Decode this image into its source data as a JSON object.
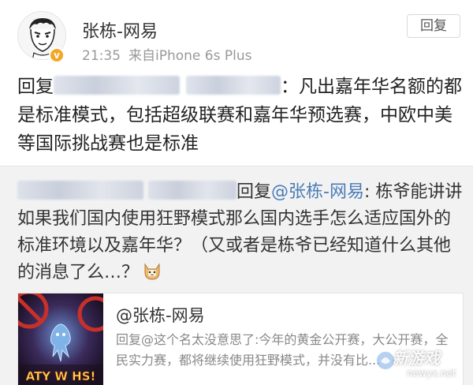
{
  "post": {
    "author": "张栋-网易",
    "time": "21:35",
    "source": "来自iPhone 6s Plus",
    "reply_button": "回复",
    "reply_prefix": "回复",
    "text_after_mention": "：凡出嘉年华名额的都是标准模式，包括超级联赛和嘉年华预选赛，中欧中美等国际挑战赛也是标准"
  },
  "quoted": {
    "reply_prefix": "回复",
    "mention": "@张栋-网易",
    "text": ": 栋爷能讲讲如果我们国内使用狂野模式那么国内选手怎么适应国外的标准环境以及嘉年华？（又或者是栋爷已经知道什么其他的消息了么…？",
    "emoji": "cat-emoji"
  },
  "card": {
    "title": "@张栋-网易",
    "description": "回复@这个名太没意思了:今年的黄金公开赛，大公开赛，全民实力赛，都将继续使用狂野模式，并没有比...",
    "thumb_text": "ATY W HS!"
  },
  "watermark": {
    "brand": "新游戏",
    "url": "newyx.net"
  },
  "colors": {
    "mention": "#4a7bb7",
    "verified": "#f5a623",
    "quoted_bg": "#f2f2f2"
  }
}
